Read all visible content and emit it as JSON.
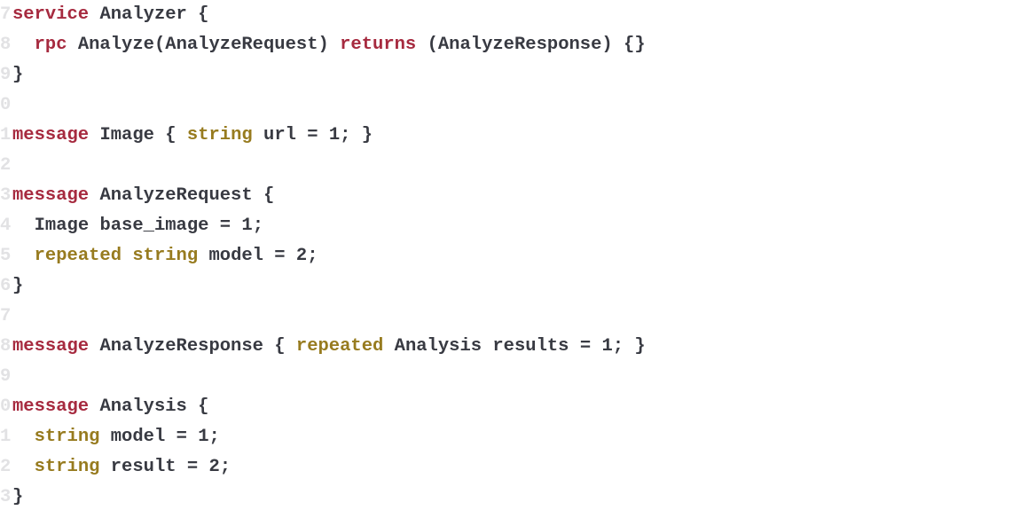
{
  "code": {
    "lines": [
      {
        "num": "7",
        "indent": 0,
        "tokens": [
          {
            "t": "service",
            "c": "kw-red"
          },
          {
            "t": " "
          },
          {
            "t": "Analyzer",
            "c": "ident"
          },
          {
            "t": " "
          },
          {
            "t": "{",
            "c": "punc"
          }
        ]
      },
      {
        "num": "8",
        "indent": 1,
        "tokens": [
          {
            "t": "rpc",
            "c": "kw-red"
          },
          {
            "t": " "
          },
          {
            "t": "Analyze",
            "c": "ident"
          },
          {
            "t": "(",
            "c": "punc"
          },
          {
            "t": "AnalyzeRequest",
            "c": "ident"
          },
          {
            "t": ")",
            "c": "punc"
          },
          {
            "t": " "
          },
          {
            "t": "returns",
            "c": "kw-red"
          },
          {
            "t": " "
          },
          {
            "t": "(",
            "c": "punc"
          },
          {
            "t": "AnalyzeResponse",
            "c": "ident"
          },
          {
            "t": ")",
            "c": "punc"
          },
          {
            "t": " "
          },
          {
            "t": "{}",
            "c": "punc"
          }
        ]
      },
      {
        "num": "9",
        "indent": 0,
        "tokens": [
          {
            "t": "}",
            "c": "punc"
          }
        ]
      },
      {
        "num": "0",
        "indent": 0,
        "tokens": []
      },
      {
        "num": "1",
        "indent": 0,
        "tokens": [
          {
            "t": "message",
            "c": "kw-red"
          },
          {
            "t": " "
          },
          {
            "t": "Image",
            "c": "ident"
          },
          {
            "t": " "
          },
          {
            "t": "{",
            "c": "punc"
          },
          {
            "t": " "
          },
          {
            "t": "string",
            "c": "kw-olive"
          },
          {
            "t": " "
          },
          {
            "t": "url",
            "c": "ident"
          },
          {
            "t": " "
          },
          {
            "t": "=",
            "c": "punc"
          },
          {
            "t": " "
          },
          {
            "t": "1",
            "c": "num"
          },
          {
            "t": ";",
            "c": "punc"
          },
          {
            "t": " "
          },
          {
            "t": "}",
            "c": "punc"
          }
        ]
      },
      {
        "num": "2",
        "indent": 0,
        "tokens": []
      },
      {
        "num": "3",
        "indent": 0,
        "tokens": [
          {
            "t": "message",
            "c": "kw-red"
          },
          {
            "t": " "
          },
          {
            "t": "AnalyzeRequest",
            "c": "ident"
          },
          {
            "t": " "
          },
          {
            "t": "{",
            "c": "punc"
          }
        ]
      },
      {
        "num": "4",
        "indent": 1,
        "tokens": [
          {
            "t": "Image",
            "c": "ident"
          },
          {
            "t": " "
          },
          {
            "t": "base_image",
            "c": "ident"
          },
          {
            "t": " "
          },
          {
            "t": "=",
            "c": "punc"
          },
          {
            "t": " "
          },
          {
            "t": "1",
            "c": "num"
          },
          {
            "t": ";",
            "c": "punc"
          }
        ]
      },
      {
        "num": "5",
        "indent": 1,
        "tokens": [
          {
            "t": "repeated",
            "c": "kw-olive"
          },
          {
            "t": " "
          },
          {
            "t": "string",
            "c": "kw-olive"
          },
          {
            "t": " "
          },
          {
            "t": "model",
            "c": "ident"
          },
          {
            "t": " "
          },
          {
            "t": "=",
            "c": "punc"
          },
          {
            "t": " "
          },
          {
            "t": "2",
            "c": "num"
          },
          {
            "t": ";",
            "c": "punc"
          }
        ]
      },
      {
        "num": "6",
        "indent": 0,
        "tokens": [
          {
            "t": "}",
            "c": "punc"
          }
        ]
      },
      {
        "num": "7",
        "indent": 0,
        "tokens": []
      },
      {
        "num": "8",
        "indent": 0,
        "tokens": [
          {
            "t": "message",
            "c": "kw-red"
          },
          {
            "t": " "
          },
          {
            "t": "AnalyzeResponse",
            "c": "ident"
          },
          {
            "t": " "
          },
          {
            "t": "{",
            "c": "punc"
          },
          {
            "t": " "
          },
          {
            "t": "repeated",
            "c": "kw-olive"
          },
          {
            "t": " "
          },
          {
            "t": "Analysis",
            "c": "ident"
          },
          {
            "t": " "
          },
          {
            "t": "results",
            "c": "ident"
          },
          {
            "t": " "
          },
          {
            "t": "=",
            "c": "punc"
          },
          {
            "t": " "
          },
          {
            "t": "1",
            "c": "num"
          },
          {
            "t": ";",
            "c": "punc"
          },
          {
            "t": " "
          },
          {
            "t": "}",
            "c": "punc"
          }
        ]
      },
      {
        "num": "9",
        "indent": 0,
        "tokens": []
      },
      {
        "num": "0",
        "indent": 0,
        "tokens": [
          {
            "t": "message",
            "c": "kw-red"
          },
          {
            "t": " "
          },
          {
            "t": "Analysis",
            "c": "ident"
          },
          {
            "t": " "
          },
          {
            "t": "{",
            "c": "punc"
          }
        ]
      },
      {
        "num": "1",
        "indent": 1,
        "tokens": [
          {
            "t": "string",
            "c": "kw-olive"
          },
          {
            "t": " "
          },
          {
            "t": "model",
            "c": "ident"
          },
          {
            "t": " "
          },
          {
            "t": "=",
            "c": "punc"
          },
          {
            "t": " "
          },
          {
            "t": "1",
            "c": "num"
          },
          {
            "t": ";",
            "c": "punc"
          }
        ]
      },
      {
        "num": "2",
        "indent": 1,
        "tokens": [
          {
            "t": "string",
            "c": "kw-olive"
          },
          {
            "t": " "
          },
          {
            "t": "result",
            "c": "ident"
          },
          {
            "t": " "
          },
          {
            "t": "=",
            "c": "punc"
          },
          {
            "t": " "
          },
          {
            "t": "2",
            "c": "num"
          },
          {
            "t": ";",
            "c": "punc"
          }
        ]
      },
      {
        "num": "3",
        "indent": 0,
        "tokens": [
          {
            "t": "}",
            "c": "punc"
          }
        ]
      }
    ],
    "indentUnit": "  "
  }
}
